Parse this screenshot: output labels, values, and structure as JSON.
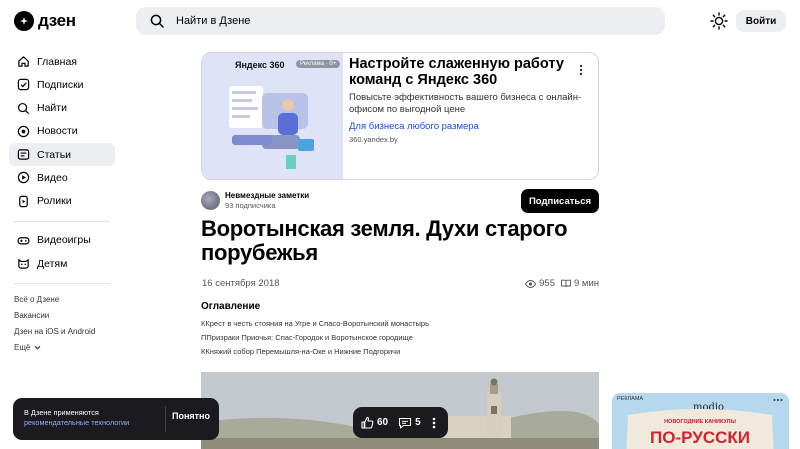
{
  "header": {
    "logo": "дзен",
    "search_placeholder": "Найти в Дзене",
    "login_label": "Войти"
  },
  "sidebar": {
    "items": [
      {
        "label": "Главная",
        "icon": "home-icon"
      },
      {
        "label": "Подписки",
        "icon": "subscriptions-icon"
      },
      {
        "label": "Найти",
        "icon": "search-icon"
      },
      {
        "label": "Новости",
        "icon": "news-icon"
      },
      {
        "label": "Статьи",
        "icon": "articles-icon",
        "active": true
      },
      {
        "label": "Видео",
        "icon": "video-icon"
      },
      {
        "label": "Ролики",
        "icon": "shorts-icon"
      }
    ],
    "extra": [
      {
        "label": "Видеоигры",
        "icon": "gamepad-icon"
      },
      {
        "label": "Детям",
        "icon": "kids-icon"
      }
    ],
    "links": [
      "Всё о Дзене",
      "Вакансии",
      "Дзен на iOS и Android",
      "Ещё"
    ]
  },
  "ad": {
    "badge": "Реклама · 0+",
    "brand": "Яндекс 360",
    "title": "Настройте слаженную работу команд с Яндекс 360",
    "description": "Повысьте эффективность вашего бизнеса с онлайн-офисом по выгодной цене",
    "link": "Для бизнеса любого размера",
    "domain": "360.yandex.by"
  },
  "author": {
    "name": "Невмездные заметки",
    "subscribers": "93 подписчика",
    "subscribe_label": "Подписаться"
  },
  "article": {
    "title": "Воротынская земля. Духи старого порубежья",
    "date": "16 сентября 2018",
    "views": "955",
    "read_time": "9 мин",
    "toc_heading": "Оглавление",
    "toc": [
      "ККрест в честь стояния на Угре и Спасо-Воротынский монастырь",
      "ППризраки Приочья: Спас-Городок и Воротынское городище",
      "ККняжий собор Перемышля-на-Оке и Нижние Подгоричи"
    ]
  },
  "reactions": {
    "likes": "60",
    "comments": "5"
  },
  "cookie": {
    "text": "В Дзене применяются",
    "link": "рекомендательные технологии",
    "ok_label": "Понятно"
  },
  "side_ad": {
    "label": "РЕКЛАМА",
    "brand": "modjo",
    "banner_text": "НОВОГОДНИЕ КАНИКУЛЫ",
    "banner_big": "ПО-РУССКИ"
  },
  "colors": {
    "accent_link": "#1a4fcc",
    "dark": "#1b1b1f",
    "surface": "#edeef2"
  }
}
